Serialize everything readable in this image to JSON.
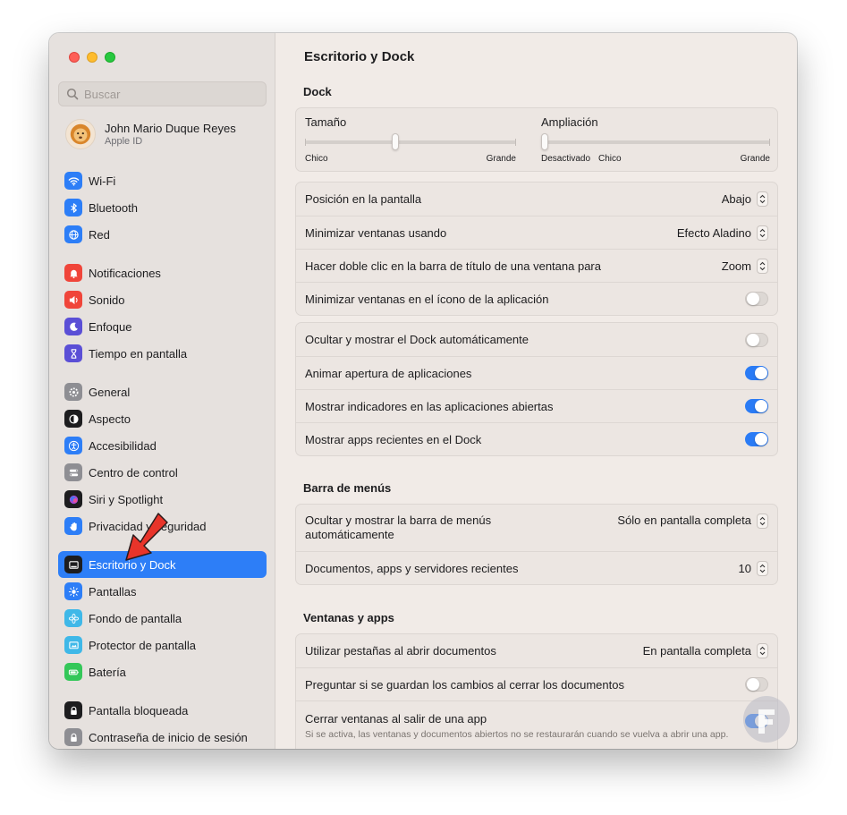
{
  "sidebar": {
    "search_placeholder": "Buscar",
    "account": {
      "name": "John Mario Duque Reyes",
      "sub": "Apple ID"
    },
    "groups": [
      [
        {
          "label": "Wi-Fi",
          "icon": "wifi-icon",
          "color": "#2d7ef7"
        },
        {
          "label": "Bluetooth",
          "icon": "bluetooth-icon",
          "color": "#2d7ef7"
        },
        {
          "label": "Red",
          "icon": "globe-icon",
          "color": "#2d7ef7"
        }
      ],
      [
        {
          "label": "Notificaciones",
          "icon": "bell-icon",
          "color": "#f0453a"
        },
        {
          "label": "Sonido",
          "icon": "speaker-icon",
          "color": "#f0453a"
        },
        {
          "label": "Enfoque",
          "icon": "moon-icon",
          "color": "#5b4fd6"
        },
        {
          "label": "Tiempo en pantalla",
          "icon": "hourglass-icon",
          "color": "#5b4fd6"
        }
      ],
      [
        {
          "label": "General",
          "icon": "gear-icon",
          "color": "#8e8e93"
        },
        {
          "label": "Aspecto",
          "icon": "appearance-icon",
          "color": "#1d1d1f"
        },
        {
          "label": "Accesibilidad",
          "icon": "accessibility-icon",
          "color": "#2d7ef7"
        },
        {
          "label": "Centro de control",
          "icon": "toggles-icon",
          "color": "#8e8e93"
        },
        {
          "label": "Siri y Spotlight",
          "icon": "siri-icon",
          "color": "#1d1d1f"
        },
        {
          "label": "Privacidad y seguridad",
          "icon": "hand-icon",
          "color": "#2d7ef7"
        }
      ],
      [
        {
          "label": "Escritorio y Dock",
          "icon": "dock-icon",
          "color": "#1d1d1f",
          "active": true
        },
        {
          "label": "Pantallas",
          "icon": "sun-icon",
          "color": "#2d7ef7"
        },
        {
          "label": "Fondo de pantalla",
          "icon": "flower-icon",
          "color": "#3fb8e8"
        },
        {
          "label": "Protector de pantalla",
          "icon": "screensaver-icon",
          "color": "#3fb8e8"
        },
        {
          "label": "Batería",
          "icon": "battery-icon",
          "color": "#34c759"
        }
      ],
      [
        {
          "label": "Pantalla bloqueada",
          "icon": "lock-icon",
          "color": "#1d1d1f"
        },
        {
          "label": "Contraseña de inicio de sesión",
          "icon": "lock-icon",
          "color": "#8e8e93"
        }
      ]
    ]
  },
  "main": {
    "title": "Escritorio y Dock",
    "dock_section": "Dock",
    "size_slider": {
      "label": "Tamaño",
      "min_label": "Chico",
      "max_label": "Grande",
      "value_fraction": 0.43
    },
    "magnification_slider": {
      "label": "Ampliación",
      "off_label": "Desactivado",
      "min_label": "Chico",
      "max_label": "Grande",
      "value_fraction": 0.0
    },
    "dock_rows": [
      {
        "label": "Posición en la pantalla",
        "value": "Abajo"
      },
      {
        "label": "Minimizar ventanas usando",
        "value": "Efecto Aladino"
      },
      {
        "label": "Hacer doble clic en la barra de título de una ventana para",
        "value": "Zoom"
      },
      {
        "label": "Minimizar ventanas en el ícono de la aplicación",
        "toggle": false
      }
    ],
    "dock_toggles": [
      {
        "label": "Ocultar y mostrar el Dock automáticamente",
        "toggle": false
      },
      {
        "label": "Animar apertura de aplicaciones",
        "toggle": true
      },
      {
        "label": "Mostrar indicadores en las aplicaciones abiertas",
        "toggle": true
      },
      {
        "label": "Mostrar apps recientes en el Dock",
        "toggle": true
      }
    ],
    "menubar_section": "Barra de menús",
    "menubar_rows": [
      {
        "label_line1": "Ocultar y mostrar la barra de menús",
        "label_line2": "automáticamente",
        "value": "Sólo en pantalla completa"
      },
      {
        "label": "Documentos, apps y servidores recientes",
        "value": "10"
      }
    ],
    "windows_section": "Ventanas y apps",
    "windows_rows": [
      {
        "label": "Utilizar pestañas al abrir documentos",
        "value": "En pantalla completa"
      },
      {
        "label": "Preguntar si se guardan los cambios al cerrar los documentos",
        "toggle": false
      },
      {
        "label": "Cerrar ventanas al salir de una app",
        "toggle": true,
        "description": "Si se activa, las ventanas y documentos abiertos no se restaurarán cuando se vuelva a abrir una app."
      }
    ]
  },
  "colors": {
    "accent": "#2d7ef7",
    "annotation_arrow": "#e8342a"
  }
}
